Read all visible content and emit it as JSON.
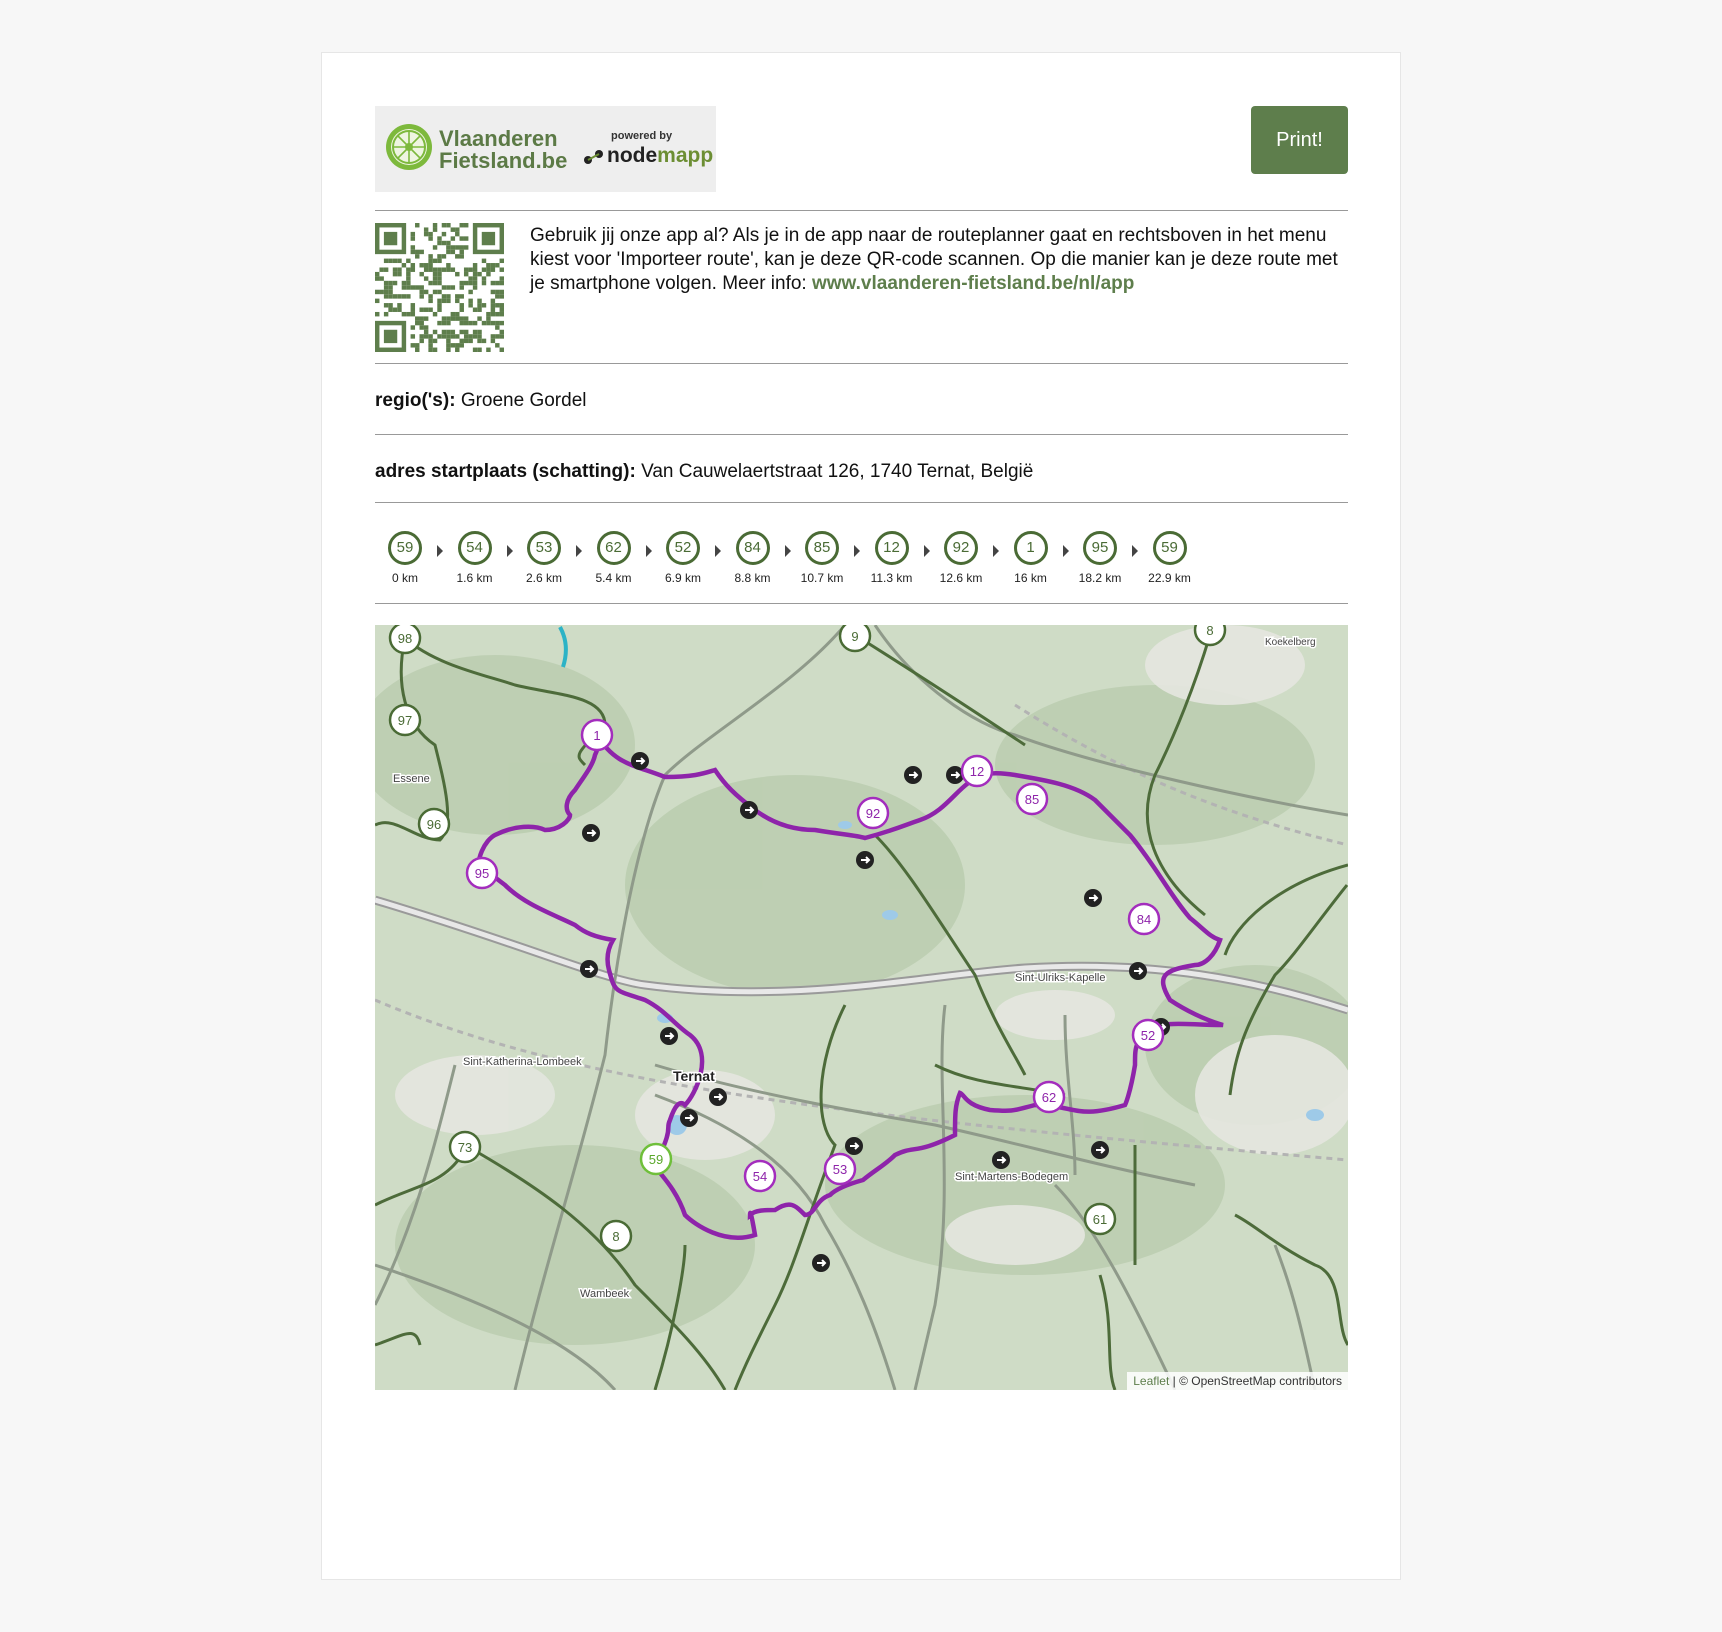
{
  "logo": {
    "line1": "Vlaanderen",
    "line2": "Fietsland.be",
    "powered_by": "powered by",
    "nodemapp_a": "node",
    "nodemapp_b": "mapp"
  },
  "print_label": "Print!",
  "qr_section": {
    "text": "Gebruik jij onze app al? Als je in de app naar de routeplanner gaat en rechtsboven in het menu kiest voor 'Importeer route', kan je deze QR-code scannen. Op die manier kan je deze route met je smartphone volgen. Meer info: ",
    "link": "www.vlaanderen-fietsland.be/nl/app"
  },
  "region": {
    "label": "regio('s):",
    "value": "Groene Gordel"
  },
  "start_address": {
    "label": "adres startplaats (schatting):",
    "value": "Van Cauwelaertstraat 126, 1740 Ternat, België"
  },
  "route_nodes": [
    {
      "num": "59",
      "km": "0 km"
    },
    {
      "num": "54",
      "km": "1.6 km"
    },
    {
      "num": "53",
      "km": "2.6 km"
    },
    {
      "num": "62",
      "km": "5.4 km"
    },
    {
      "num": "52",
      "km": "6.9 km"
    },
    {
      "num": "84",
      "km": "8.8 km"
    },
    {
      "num": "85",
      "km": "10.7 km"
    },
    {
      "num": "12",
      "km": "11.3 km"
    },
    {
      "num": "92",
      "km": "12.6 km"
    },
    {
      "num": "1",
      "km": "16 km"
    },
    {
      "num": "95",
      "km": "18.2 km"
    },
    {
      "num": "59",
      "km": "22.9 km"
    }
  ],
  "map": {
    "place_labels": [
      "Essene",
      "Sint-Katherina-Lombeek",
      "Ternat",
      "Sint-Ulriks-Kapelle",
      "Sint-Martens-Bodegem",
      "Wambeek",
      "Koekelberg"
    ],
    "route_markers": [
      "1",
      "95",
      "92",
      "12",
      "85",
      "84",
      "52",
      "62",
      "53",
      "54",
      "59"
    ],
    "other_markers": [
      "98",
      "97",
      "96",
      "73",
      "8",
      "9",
      "8",
      "61"
    ],
    "attribution_leaflet": "Leaflet",
    "attribution_rest": " | © OpenStreetMap contributors"
  },
  "colors": {
    "accent": "#5e7e4c",
    "route": "#8e24aa",
    "start_node": "#6fbf3a"
  }
}
